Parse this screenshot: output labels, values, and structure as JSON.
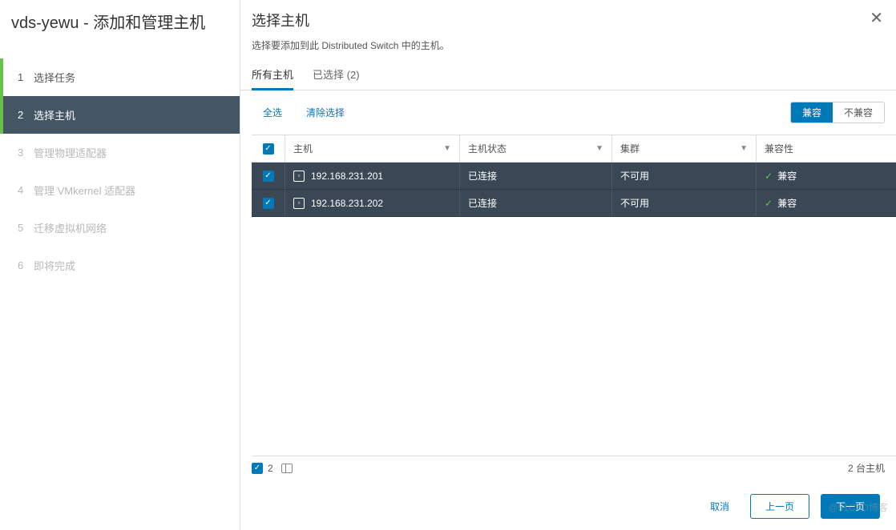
{
  "sidebar": {
    "title": "vds-yewu - 添加和管理主机",
    "steps": [
      {
        "num": "1",
        "label": "选择任务",
        "state": "completed"
      },
      {
        "num": "2",
        "label": "选择主机",
        "state": "active"
      },
      {
        "num": "3",
        "label": "管理物理适配器",
        "state": "pending"
      },
      {
        "num": "4",
        "label": "管理 VMkernel 适配器",
        "state": "pending"
      },
      {
        "num": "5",
        "label": "迁移虚拟机网络",
        "state": "pending"
      },
      {
        "num": "6",
        "label": "即将完成",
        "state": "pending"
      }
    ]
  },
  "main": {
    "title": "选择主机",
    "subtitle": "选择要添加到此 Distributed Switch 中的主机。",
    "tabs": {
      "all": "所有主机",
      "selected_prefix": "已选择",
      "selected_count": "(2)"
    },
    "actions": {
      "select_all": "全选",
      "clear": "清除选择"
    },
    "filter_toggle": {
      "compatible": "兼容",
      "incompatible": "不兼容"
    },
    "columns": {
      "host": "主机",
      "status": "主机状态",
      "cluster": "集群",
      "compat": "兼容性"
    },
    "rows": [
      {
        "checked": true,
        "host": "192.168.231.201",
        "status": "已连接",
        "cluster": "不可用",
        "compat": "兼容"
      },
      {
        "checked": true,
        "host": "192.168.231.202",
        "status": "已连接",
        "cluster": "不可用",
        "compat": "兼容"
      }
    ],
    "footer": {
      "selected_count": "2",
      "total_label": "2 台主机"
    },
    "buttons": {
      "cancel": "取消",
      "prev": "上一页",
      "next": "下一页"
    }
  },
  "watermark": "@51CTO博客"
}
